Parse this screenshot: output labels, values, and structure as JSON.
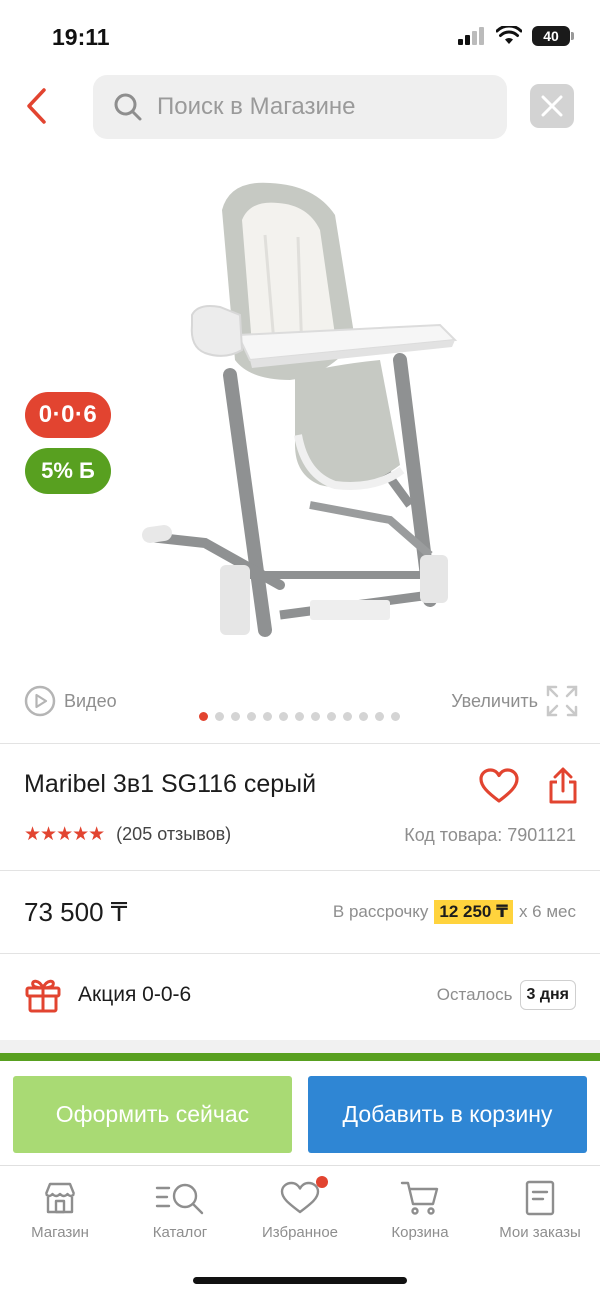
{
  "status_bar": {
    "time": "19:11",
    "battery": "40"
  },
  "search": {
    "placeholder": "Поиск в Магазине"
  },
  "gallery": {
    "badge_installment": "0·0·6",
    "badge_bonus": "5% Б",
    "video_label": "Видео",
    "zoom_label": "Увеличить",
    "dots_total": 13,
    "active_dot": 1
  },
  "product": {
    "title": "Maribel 3в1 SG116 серый",
    "stars": "★★★★★",
    "reviews": "(205 отзывов)",
    "sku": "Код товара: 7901121"
  },
  "price": {
    "value": "73 500 ₸",
    "installment_prefix": "В рассрочку",
    "installment_amount": "12 250 ₸",
    "installment_suffix": "x 6 мес"
  },
  "promo": {
    "title": "Акция 0-0-6",
    "remaining_label": "Осталось",
    "remaining_days": "3 дня"
  },
  "actions": {
    "checkout": "Оформить сейчас",
    "add_to_cart": "Добавить в корзину"
  },
  "tabbar": {
    "items": [
      {
        "label": "Магазин",
        "icon": "shop-icon"
      },
      {
        "label": "Каталог",
        "icon": "catalog-icon"
      },
      {
        "label": "Избранное",
        "icon": "heart-icon"
      },
      {
        "label": "Корзина",
        "icon": "cart-icon"
      },
      {
        "label": "Мои заказы",
        "icon": "orders-icon"
      }
    ]
  },
  "colors": {
    "accent_red": "#e24430",
    "green": "#58a020",
    "checkout_green": "#a9da74",
    "cart_blue": "#2f86d4",
    "installment_yellow": "#ffd33d"
  }
}
